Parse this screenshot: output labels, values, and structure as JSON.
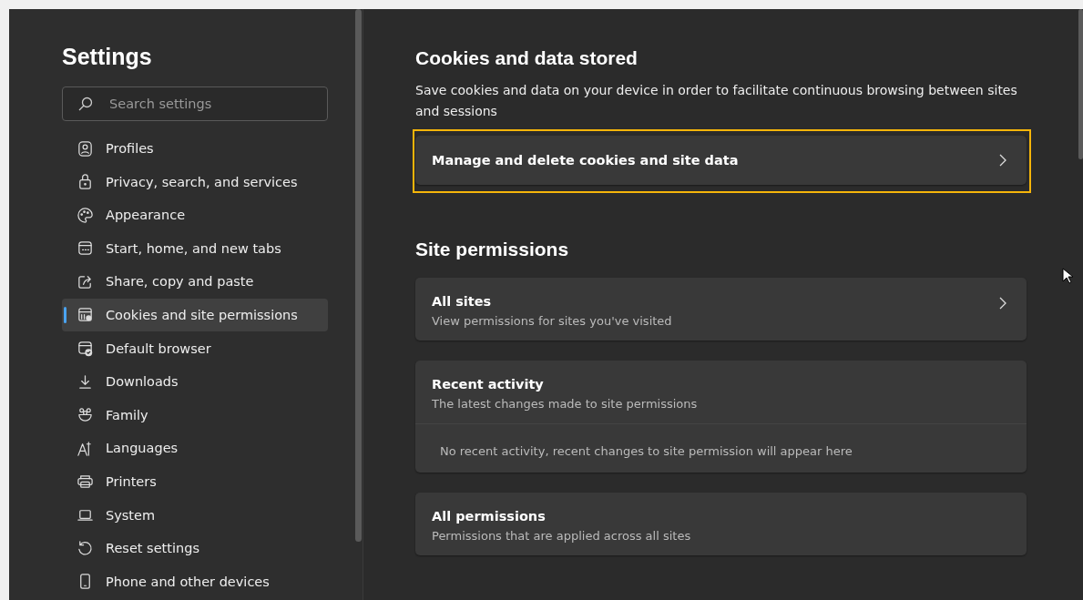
{
  "sidebar": {
    "title": "Settings",
    "search": {
      "placeholder": "Search settings"
    },
    "items": [
      {
        "label": "Profiles",
        "selected": false
      },
      {
        "label": "Privacy, search, and services",
        "selected": false
      },
      {
        "label": "Appearance",
        "selected": false
      },
      {
        "label": "Start, home, and new tabs",
        "selected": false
      },
      {
        "label": "Share, copy and paste",
        "selected": false
      },
      {
        "label": "Cookies and site permissions",
        "selected": true
      },
      {
        "label": "Default browser",
        "selected": false
      },
      {
        "label": "Downloads",
        "selected": false
      },
      {
        "label": "Family",
        "selected": false
      },
      {
        "label": "Languages",
        "selected": false
      },
      {
        "label": "Printers",
        "selected": false
      },
      {
        "label": "System",
        "selected": false
      },
      {
        "label": "Reset settings",
        "selected": false
      },
      {
        "label": "Phone and other devices",
        "selected": false
      }
    ]
  },
  "cookies": {
    "heading": "Cookies and data stored",
    "description": "Save cookies and data on your device in order to facilitate continuous browsing between sites and sessions",
    "card": {
      "title": "Manage and delete cookies and site data",
      "highlighted": true
    }
  },
  "permissions": {
    "heading": "Site permissions",
    "cards": [
      {
        "title": "All sites",
        "subtitle": "View permissions for sites you've visited",
        "chevron": true
      },
      {
        "title": "Recent activity",
        "subtitle": "The latest changes made to site permissions",
        "chevron": false,
        "empty_note": "No recent activity, recent changes to site permission will appear here"
      },
      {
        "title": "All permissions",
        "subtitle": "Permissions that are applied across all sites",
        "chevron": false
      }
    ]
  }
}
